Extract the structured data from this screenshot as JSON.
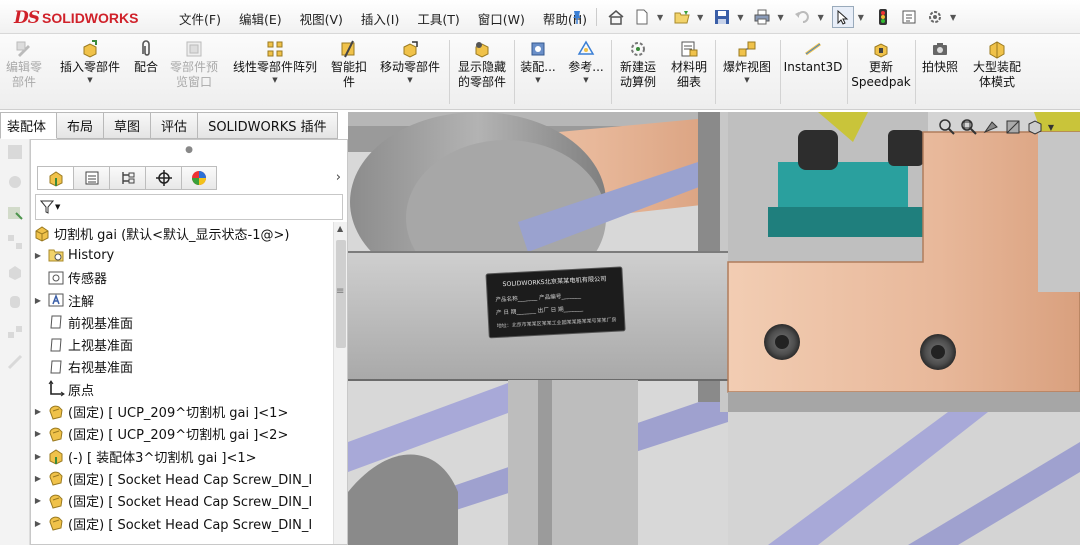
{
  "app": {
    "logo_ds": "DS",
    "logo_name": "SOLIDWORKS"
  },
  "menus": [
    "文件(F)",
    "编辑(E)",
    "视图(V)",
    "插入(I)",
    "工具(T)",
    "窗口(W)",
    "帮助(H)"
  ],
  "quickbar": [
    "pin-icon",
    "home-icon",
    "new-document-icon",
    "open-icon",
    "save-icon",
    "print-icon",
    "undo-icon",
    "select-pointer-icon",
    "traffic-light-icon",
    "file-properties-icon",
    "options-gear-icon"
  ],
  "command_manager": {
    "edit_component": "编辑零\n部件",
    "insert_component": "插入零部件",
    "mate": "配合",
    "component_preview": "零部件预\n览窗口",
    "linear_pattern": "线性零部件阵列",
    "smart_fasteners": "智能扣\n件",
    "move_component": "移动零部件",
    "show_hidden": "显示隐藏\n的零部件",
    "assembly_features": "装配...",
    "reference_geometry": "参考...",
    "new_motion_study": "新建运\n动算例",
    "bill_of_materials": "材料明\n细表",
    "exploded_view": "爆炸视图",
    "instant3d": "Instant3D",
    "update_speedpak": "更新\nSpeedpak",
    "take_snapshot": "拍快照",
    "large_assembly_mode": "大型装配\n体模式"
  },
  "tabs": [
    "装配体",
    "布局",
    "草图",
    "评估",
    "SOLIDWORKS 插件"
  ],
  "feature_tree": {
    "root": "切割机 gai  (默认<默认_显示状态-1@>)",
    "items": [
      {
        "label": "History",
        "icon": "history-folder-icon",
        "expandable": true
      },
      {
        "label": "传感器",
        "icon": "sensor-icon",
        "expandable": false
      },
      {
        "label": "注解",
        "icon": "annotation-icon",
        "expandable": true
      },
      {
        "label": "前视基准面",
        "icon": "plane-icon",
        "expandable": false
      },
      {
        "label": "上视基准面",
        "icon": "plane-icon",
        "expandable": false
      },
      {
        "label": "右视基准面",
        "icon": "plane-icon",
        "expandable": false
      },
      {
        "label": "原点",
        "icon": "origin-icon",
        "expandable": false
      },
      {
        "label": "(固定) [ UCP_209^切割机 gai ]<1>",
        "icon": "part-icon",
        "expandable": true
      },
      {
        "label": "(固定) [ UCP_209^切割机 gai ]<2>",
        "icon": "part-icon",
        "expandable": true
      },
      {
        "label": "(-) [ 装配体3^切割机 gai ]<1>",
        "icon": "subassembly-icon",
        "expandable": true
      },
      {
        "label": "(固定) [ Socket Head Cap Screw_DIN_I",
        "icon": "part-icon",
        "expandable": true
      },
      {
        "label": "(固定) [ Socket Head Cap Screw_DIN_I",
        "icon": "part-icon",
        "expandable": true
      },
      {
        "label": "(固定) [ Socket Head Cap Screw_DIN_I",
        "icon": "part-icon",
        "expandable": true
      }
    ]
  },
  "nameplate": {
    "header": "SOLIDWORKS北京某某电机有限公司",
    "line1": "产品名称_______  产品编号_______",
    "line2": "产 日 期_______  出厂 日 期_______",
    "line3": "地址：北京市某某区某某工业园某某路某某号某某厂房"
  },
  "colors": {
    "accent_red": "#d0212a",
    "copper": "#e8b89a",
    "steel": "#9a9a9a",
    "teal": "#2aa09e",
    "selection_blue": "#6f7fc6"
  }
}
